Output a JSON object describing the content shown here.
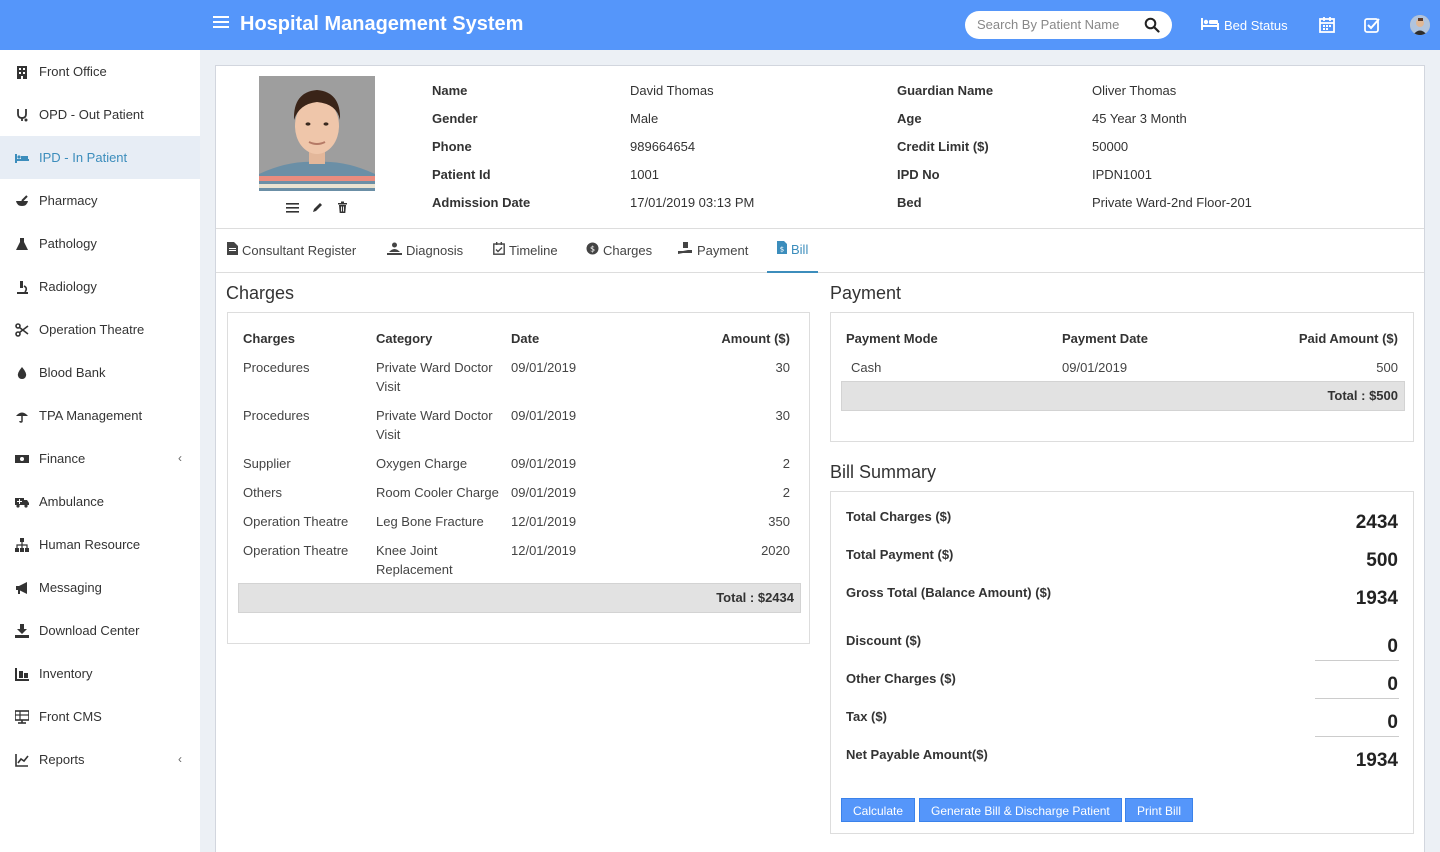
{
  "header": {
    "title": "Hospital Management System",
    "search_placeholder": "Search By Patient Name",
    "bed_status": "Bed Status"
  },
  "sidebar": {
    "items": [
      {
        "label": "Front Office",
        "icon": "building-icon"
      },
      {
        "label": "OPD - Out Patient",
        "icon": "stethoscope-icon"
      },
      {
        "label": "IPD - In Patient",
        "icon": "bed-icon",
        "active": true
      },
      {
        "label": "Pharmacy",
        "icon": "mortar-pestle-icon"
      },
      {
        "label": "Pathology",
        "icon": "flask-icon"
      },
      {
        "label": "Radiology",
        "icon": "microscope-icon"
      },
      {
        "label": "Operation Theatre",
        "icon": "scissors-icon"
      },
      {
        "label": "Blood Bank",
        "icon": "tint-icon"
      },
      {
        "label": "TPA Management",
        "icon": "umbrella-icon"
      },
      {
        "label": "Finance",
        "icon": "money-icon"
      },
      {
        "label": "Ambulance",
        "icon": "ambulance-icon"
      },
      {
        "label": "Human Resource",
        "icon": "sitemap-icon"
      },
      {
        "label": "Messaging",
        "icon": "bullhorn-icon"
      },
      {
        "label": "Download Center",
        "icon": "download-icon"
      },
      {
        "label": "Inventory",
        "icon": "inventory-icon"
      },
      {
        "label": "Front CMS",
        "icon": "cms-icon"
      },
      {
        "label": "Reports",
        "icon": "line-chart-icon"
      }
    ]
  },
  "patient": {
    "left": [
      {
        "label": "Name",
        "value": "David Thomas"
      },
      {
        "label": "Gender",
        "value": "Male"
      },
      {
        "label": "Phone",
        "value": "989664654"
      },
      {
        "label": "Patient Id",
        "value": "1001"
      },
      {
        "label": "Admission Date",
        "value": "17/01/2019 03:13 PM"
      }
    ],
    "right": [
      {
        "label": "Guardian Name",
        "value": "Oliver Thomas"
      },
      {
        "label": "Age",
        "value": "45 Year 3 Month"
      },
      {
        "label": "Credit Limit ($)",
        "value": "50000"
      },
      {
        "label": "IPD No",
        "value": "IPDN1001"
      },
      {
        "label": "Bed",
        "value": "Private Ward-2nd Floor-201"
      }
    ]
  },
  "tabs": [
    {
      "label": "Consultant Register",
      "icon": "file-icon"
    },
    {
      "label": "Diagnosis",
      "icon": "diagnosis-icon"
    },
    {
      "label": "Timeline",
      "icon": "calendar-check-icon"
    },
    {
      "label": "Charges",
      "icon": "coins-icon"
    },
    {
      "label": "Payment",
      "icon": "hand-money-icon"
    },
    {
      "label": "Bill",
      "icon": "invoice-icon",
      "active": true
    }
  ],
  "charges": {
    "title": "Charges",
    "headers": {
      "charges": "Charges",
      "category": "Category",
      "date": "Date",
      "amount": "Amount ($)"
    },
    "rows": [
      {
        "charge": "Procedures",
        "category": "Private Ward Doctor Visit",
        "date": "09/01/2019",
        "amount": "30"
      },
      {
        "charge": "Procedures",
        "category": "Private Ward Doctor Visit",
        "date": "09/01/2019",
        "amount": "30"
      },
      {
        "charge": "Supplier",
        "category": "Oxygen Charge",
        "date": "09/01/2019",
        "amount": "2"
      },
      {
        "charge": "Others",
        "category": "Room Cooler Charge",
        "date": "09/01/2019",
        "amount": "2"
      },
      {
        "charge": "Operation Theatre",
        "category": "Leg Bone Fracture",
        "date": "12/01/2019",
        "amount": "350"
      },
      {
        "charge": "Operation Theatre",
        "category": "Knee Joint Replacement",
        "date": "12/01/2019",
        "amount": "2020"
      }
    ],
    "total": "Total : $2434"
  },
  "payment": {
    "title": "Payment",
    "headers": {
      "mode": "Payment Mode",
      "date": "Payment Date",
      "amount": "Paid Amount ($)"
    },
    "rows": [
      {
        "mode": "Cash",
        "date": "09/01/2019",
        "amount": "500"
      }
    ],
    "total": "Total : $500"
  },
  "bill_summary": {
    "title": "Bill Summary",
    "rows": [
      {
        "label": "Total Charges ($)",
        "value": "2434"
      },
      {
        "label": "Total Payment ($)",
        "value": "500"
      },
      {
        "label": "Gross Total (Balance Amount) ($)",
        "value": "1934"
      },
      {
        "label": "Discount ($)",
        "value": "0"
      },
      {
        "label": "Other Charges ($)",
        "value": "0"
      },
      {
        "label": "Tax ($)",
        "value": "0"
      },
      {
        "label": "Net Payable Amount($)",
        "value": "1934"
      }
    ],
    "buttons": {
      "calculate": "Calculate",
      "generate": "Generate Bill & Discharge Patient",
      "print": "Print Bill"
    }
  },
  "colors": {
    "header": "#5596fa",
    "active_link": "#3c8dbc",
    "button": "#5596fa"
  }
}
